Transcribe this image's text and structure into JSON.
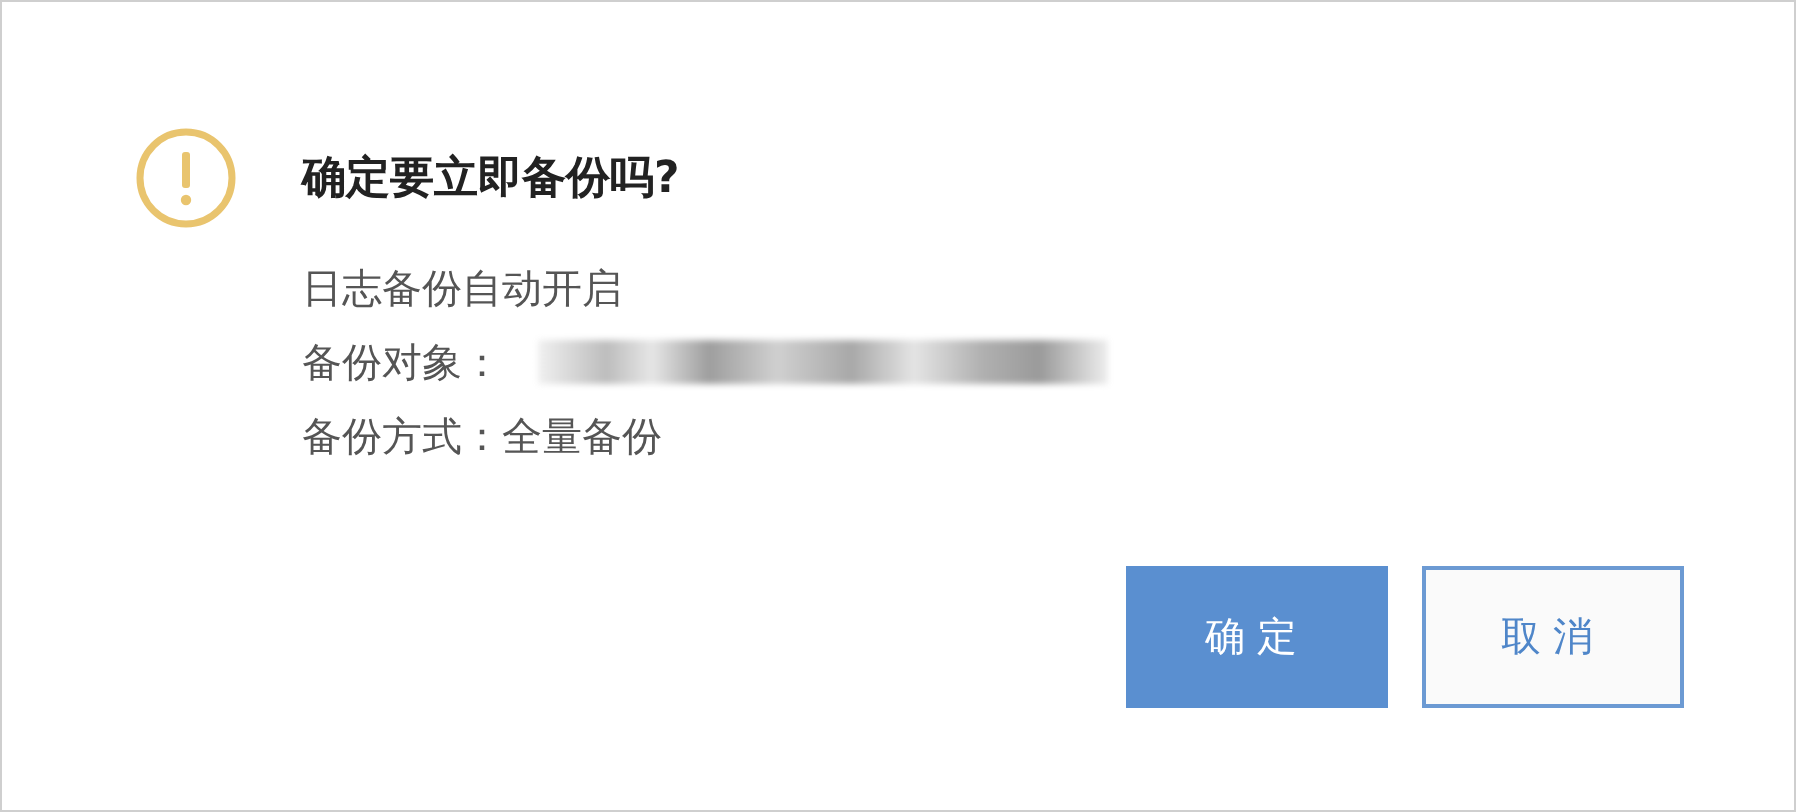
{
  "dialog": {
    "title": "确定要立即备份吗?",
    "lines": [
      {
        "kind": "text",
        "text": "日志备份自动开启"
      },
      {
        "kind": "redacted",
        "label": "备份对象："
      },
      {
        "kind": "pair",
        "label": "备份方式：",
        "value": "全量备份"
      }
    ],
    "buttons": [
      {
        "label": "确定",
        "kind": "primary"
      },
      {
        "label": "取消",
        "kind": "secondary"
      }
    ]
  }
}
